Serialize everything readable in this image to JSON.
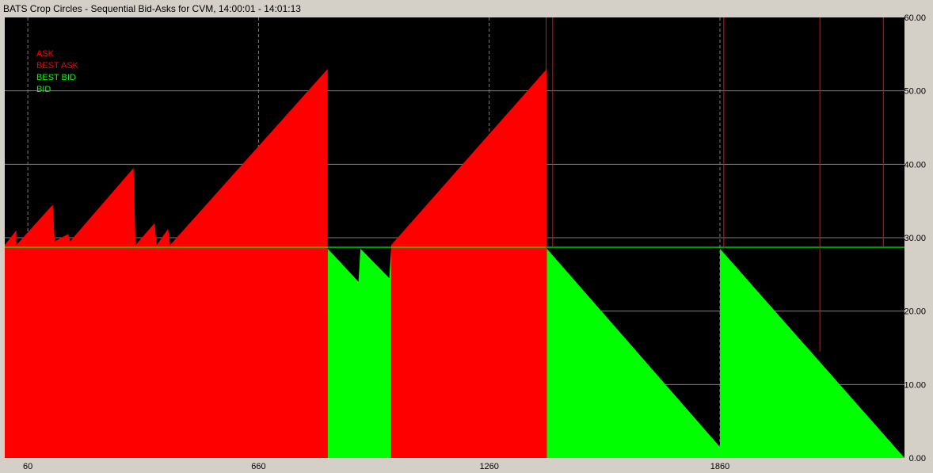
{
  "window": {
    "title": "BATS Crop Circles - Sequential Bid-Asks for CVM, 14:00:01 - 14:01:13"
  },
  "colors": {
    "background": "#000000",
    "frame": "#d4d0c8",
    "grid": "#808080",
    "ask": "#ff0000",
    "best_ask": "#ff0000",
    "best_bid": "#00ff00",
    "bid": "#00ff00"
  },
  "chart_data": {
    "type": "area",
    "title": "BATS Crop Circles - Sequential Bid-Asks for CVM, 14:00:01 - 14:01:13",
    "xlabel": "",
    "ylabel": "",
    "xlim": [
      0,
      2340
    ],
    "ylim": [
      0,
      60
    ],
    "x_ticks": [
      60,
      660,
      1260,
      1860
    ],
    "x_tick_labels": [
      "60",
      "660",
      "1260",
      "1860"
    ],
    "y_ticks": [
      0,
      10,
      20,
      30,
      40,
      50,
      60
    ],
    "y_tick_labels": [
      "0.00",
      "10.00",
      "20.00",
      "30.00",
      "40.00",
      "50.00",
      "60.00"
    ],
    "grid": true,
    "legend_position": "top-left",
    "legend": [
      {
        "label": "ASK",
        "color": "#ff0000"
      },
      {
        "label": "BEST ASK",
        "color": "#ff0000"
      },
      {
        "label": "BEST BID",
        "color": "#00ff00"
      },
      {
        "label": "BID",
        "color": "#00ff00"
      }
    ],
    "series": [
      {
        "name": "ASK",
        "segments": [
          [
            [
              0,
              29.0
            ],
            [
              30,
              31.0
            ],
            [
              30,
              29.0
            ],
            [
              125,
              34.5
            ],
            [
              130,
              29.5
            ],
            [
              165,
              30.5
            ],
            [
              170,
              29.5
            ],
            [
              335,
              39.5
            ],
            [
              340,
              29.0
            ],
            [
              390,
              32.0
            ],
            [
              395,
              29.0
            ],
            [
              425,
              31.2
            ],
            [
              430,
              29.0
            ],
            [
              840,
              53.0
            ],
            [
              840,
              0
            ],
            [
              0,
              0
            ]
          ],
          [
            [
              1005,
              29.0
            ],
            [
              1410,
              53.0
            ],
            [
              1410,
              0
            ],
            [
              1005,
              0
            ]
          ]
        ]
      },
      {
        "name": "BID",
        "segments": [
          [
            [
              840,
              28.5
            ],
            [
              920,
              24.0
            ],
            [
              925,
              28.5
            ],
            [
              1000,
              24.5
            ],
            [
              1005,
              28.5
            ],
            [
              1005,
              0
            ],
            [
              840,
              0
            ]
          ],
          [
            [
              1410,
              28.5
            ],
            [
              1860,
              1.5
            ],
            [
              1860,
              0
            ],
            [
              1410,
              0
            ]
          ],
          [
            [
              1860,
              28.5
            ],
            [
              2340,
              0.0
            ],
            [
              1860,
              0
            ]
          ]
        ]
      },
      {
        "name": "BEST BID",
        "y": 28.7,
        "x_range": [
          0,
          2340
        ]
      },
      {
        "name": "BEST ASK",
        "vlines": [
          {
            "x": 1408,
            "ymin": 0,
            "ymax": 60
          },
          {
            "x": 1425,
            "ymin": 28.7,
            "ymax": 60
          },
          {
            "x": 1870,
            "ymin": 28.7,
            "ymax": 60
          },
          {
            "x": 2120,
            "ymin": 14.5,
            "ymax": 60
          },
          {
            "x": 2285,
            "ymin": 28.7,
            "ymax": 60
          }
        ]
      }
    ]
  }
}
